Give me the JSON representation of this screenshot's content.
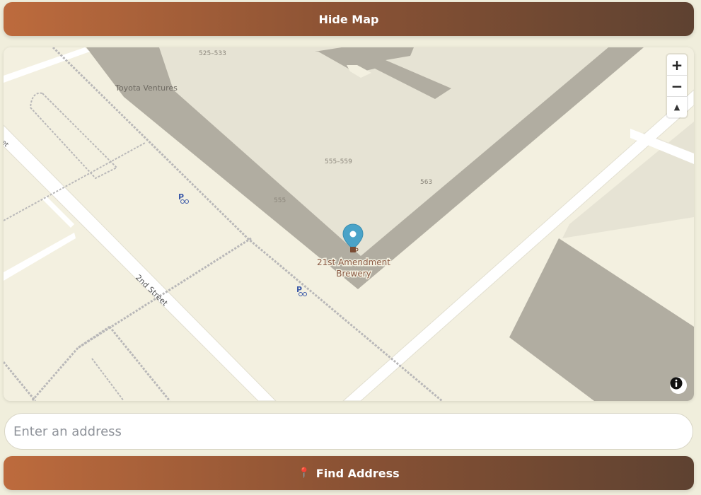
{
  "header": {
    "hide_map_label": "Hide Map"
  },
  "map": {
    "labels": {
      "toyota": "Toyota Ventures",
      "num_525": "525–533",
      "num_555_559": "555–559",
      "num_563": "563",
      "num_555": "555",
      "second_street": "2nd Street",
      "street_partial": "treet",
      "marker_line1": "21st Amendment",
      "marker_line2": "Brewery"
    },
    "controls": {
      "zoom_in": "+",
      "zoom_out": "−",
      "compass": "▲"
    },
    "bike_parking_label": "P",
    "colors": {
      "land": "#f3f0e0",
      "building": "#e6e3d4",
      "building_dark": "#b1ada1",
      "road": "#ffffff",
      "marker": "#4aa3c8"
    }
  },
  "search": {
    "placeholder": "Enter an address",
    "value": ""
  },
  "find": {
    "label": "Find Address",
    "icon": "pin-icon"
  }
}
